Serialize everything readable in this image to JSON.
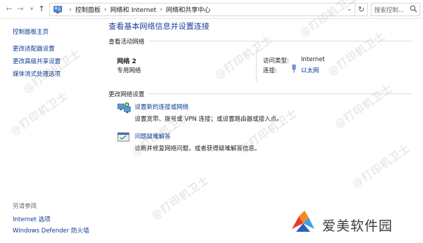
{
  "address_bar": {
    "breadcrumbs": [
      "控制面板",
      "网络和 Internet",
      "网络和共享中心"
    ],
    "search_placeholder": "搜索控制..."
  },
  "sidebar": {
    "home_link": "控制面板主页",
    "links": [
      "更改适配器设置",
      "更改高级共享设置",
      "媒体流式处理选项"
    ],
    "see_also_heading": "另请参阅",
    "see_also": [
      "Internet 选项",
      "Windows Defender 防火墙"
    ]
  },
  "main": {
    "title": "查看基本网络信息并设置连接",
    "active_networks_label": "查看活动网络",
    "network": {
      "name": "网络 2",
      "category": "专用网络",
      "access_type_label": "访问类型:",
      "access_type_value": "Internet",
      "connections_label": "连接:",
      "connections_value": "以太网"
    },
    "change_settings_label": "更改网络设置",
    "tasks": [
      {
        "title": "设置新的连接或网络",
        "description": "设置宽带、拨号或 VPN 连接；或设置路由器或接入点。",
        "icon": "network-setup-icon"
      },
      {
        "title": "问题疑难解答",
        "description": "诊断并修复网络问题，或者获得疑难解答信息。",
        "icon": "troubleshoot-icon"
      }
    ]
  },
  "watermark_text": "@打印机卫士",
  "logo": {
    "text": "爱美软件园",
    "colors": [
      "#e63c2f",
      "#f28a1e",
      "#3aa0e0",
      "#2c5fb8"
    ]
  }
}
